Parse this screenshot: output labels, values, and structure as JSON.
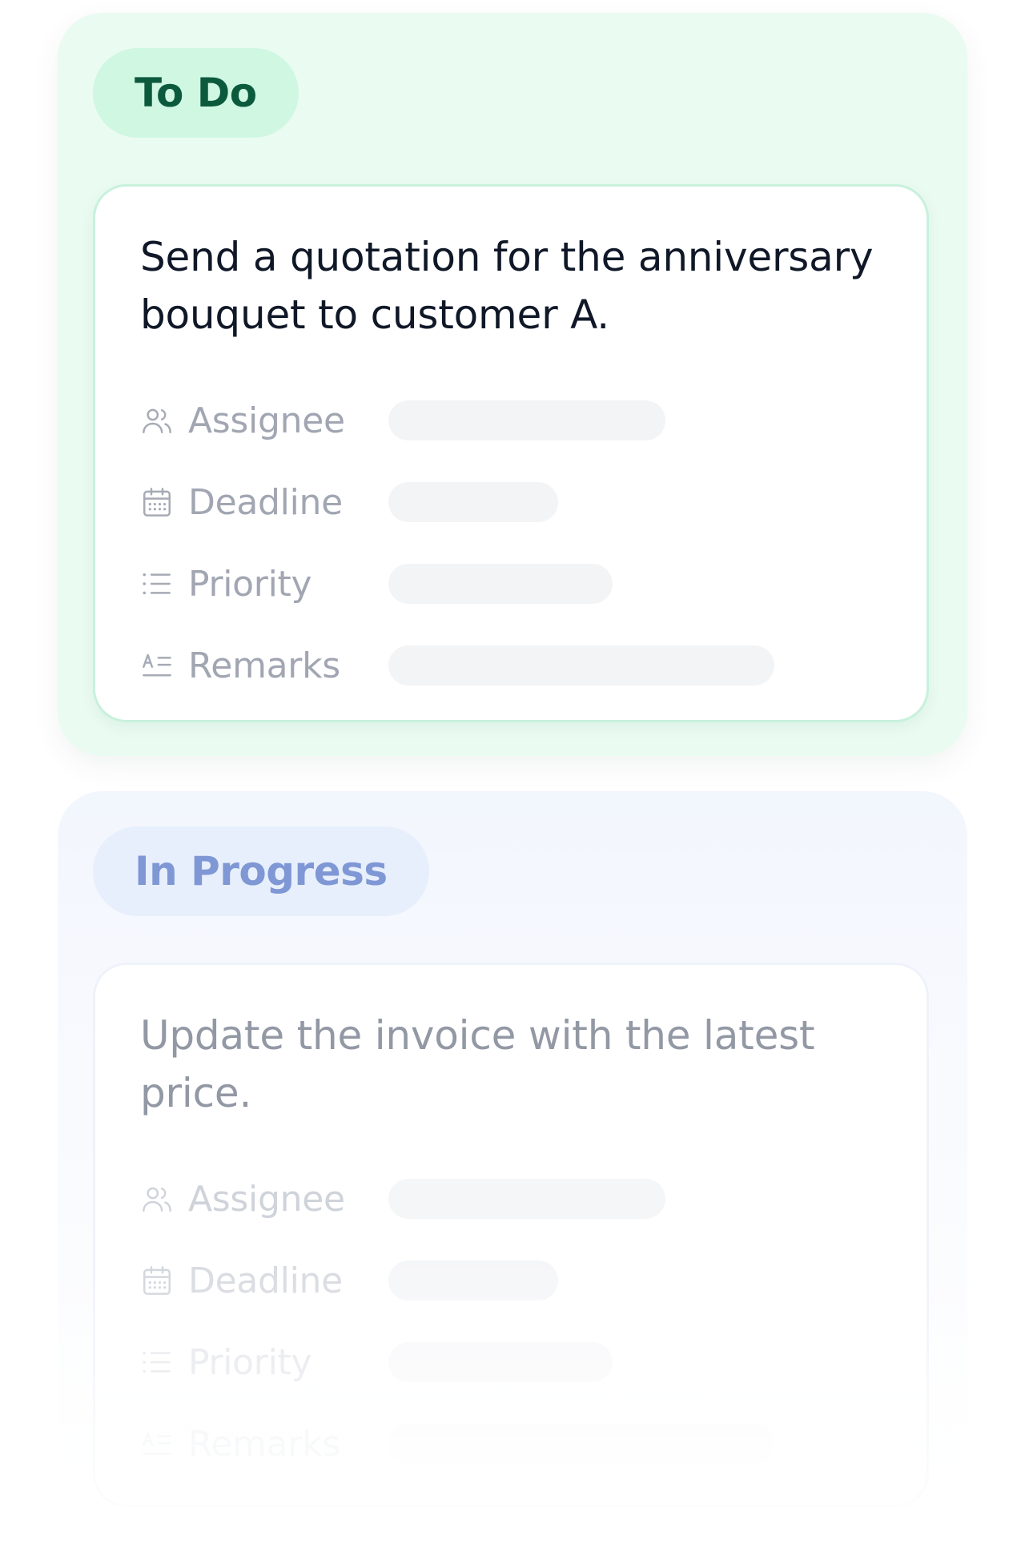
{
  "columns": [
    {
      "status": "To Do",
      "card": {
        "title": "Send a quotation for the anniversary bouquet to customer A.",
        "fields": [
          {
            "label": "Assignee",
            "icon": "users-icon"
          },
          {
            "label": "Deadline",
            "icon": "calendar-icon"
          },
          {
            "label": "Priority",
            "icon": "list-icon"
          },
          {
            "label": "Remarks",
            "icon": "text-format-icon"
          }
        ]
      }
    },
    {
      "status": "In Progress",
      "card": {
        "title": "Update the invoice with the latest price.",
        "fields": [
          {
            "label": "Assignee",
            "icon": "users-icon"
          },
          {
            "label": "Deadline",
            "icon": "calendar-icon"
          },
          {
            "label": "Priority",
            "icon": "list-icon"
          },
          {
            "label": "Remarks",
            "icon": "text-format-icon"
          }
        ]
      }
    }
  ],
  "colors": {
    "todo_background": "#eafbf2",
    "todo_pill": "#cff7e1",
    "todo_pill_text": "#0c5a3e",
    "progress_background": "#f2f6fd",
    "progress_pill": "#e7effc",
    "progress_pill_text": "#7f97d4"
  }
}
